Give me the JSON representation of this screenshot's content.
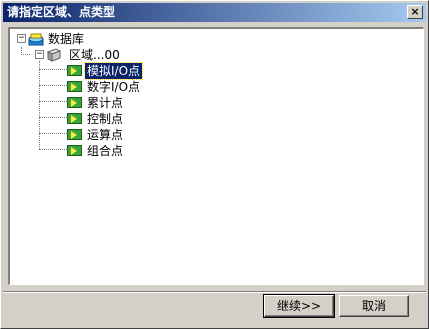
{
  "window": {
    "title": "请指定区域、点类型",
    "close_label": "×"
  },
  "tree": {
    "root": {
      "label": "数据库",
      "icon": "database-icon",
      "expander": "−"
    },
    "area": {
      "label": "区域...00",
      "icon": "folder-icon",
      "expander": "−"
    },
    "items": [
      {
        "label": "模拟I/O点",
        "icon": "point-icon",
        "selected": true
      },
      {
        "label": "数字I/O点",
        "icon": "point-icon"
      },
      {
        "label": "累计点",
        "icon": "point-icon"
      },
      {
        "label": "控制点",
        "icon": "point-icon"
      },
      {
        "label": "运算点",
        "icon": "point-icon"
      },
      {
        "label": "组合点",
        "icon": "point-icon"
      }
    ]
  },
  "buttons": {
    "continue_label": "继续>>",
    "cancel_label": "取消"
  },
  "colors": {
    "title_start": "#0a246a",
    "title_end": "#a6caf0",
    "selection": "#0a246a"
  }
}
